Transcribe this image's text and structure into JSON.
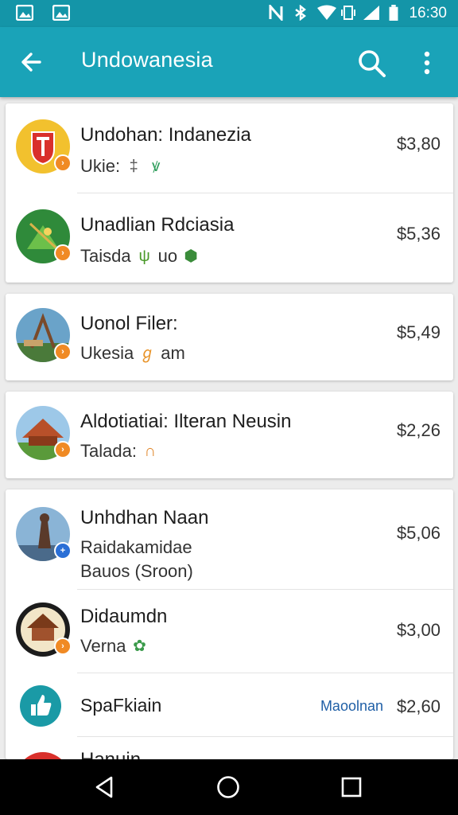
{
  "status_bar": {
    "time": "16:30"
  },
  "app_bar": {
    "title": "Undowanesia"
  },
  "items": [
    {
      "title": "Undohan: Indanezia",
      "subtitle": "Ukie:",
      "sub_glyphs": [
        "‡",
        "ꝟ"
      ],
      "price": "$3,80"
    },
    {
      "title": "Unadlian Rdciasia",
      "subtitle": "Taisda",
      "sub_suffix": "uo",
      "sub_glyphs": [
        "ψ",
        "⬢"
      ],
      "price": "$5,36"
    },
    {
      "title": "Uonol Filer:",
      "subtitle": "Ukesia",
      "sub_suffix": "am",
      "sub_glyphs": [
        "ℊ"
      ],
      "price": "$5,49"
    },
    {
      "title": "Aldotiatiai: Ilteran Neusin",
      "subtitle": "Talada:",
      "sub_glyphs": [
        "∩"
      ],
      "price": "$2,26"
    },
    {
      "title": "Unhdhan Naan",
      "subtitle": "Raidakamidae",
      "subtitle2": "Bauos (Sroon)",
      "price": "$5,06"
    },
    {
      "title": "Didaumdn",
      "subtitle": "Verna",
      "sub_glyphs": [
        "✿"
      ],
      "price": "$3,00"
    },
    {
      "title": "SpaFkiain",
      "tag": "Maoolnan",
      "price": "$2,60"
    },
    {
      "title": "Hanuin"
    }
  ],
  "colors": {
    "status_bar": "#1495a8",
    "app_bar": "#1aa3b8",
    "badge_orange": "#f08a24",
    "badge_blue": "#2a6fd6",
    "nav_bar": "#000000"
  }
}
